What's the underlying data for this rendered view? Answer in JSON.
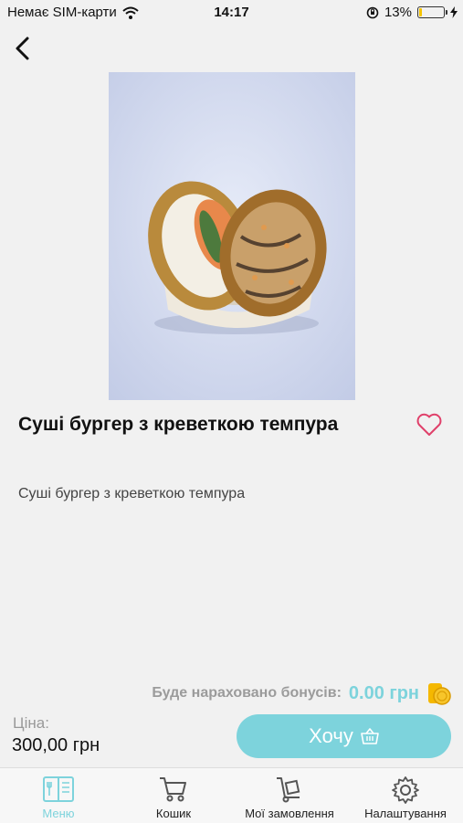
{
  "status_bar": {
    "carrier": "Немає SIM-карти",
    "time": "14:17",
    "battery": "13%",
    "battery_level": 0.13
  },
  "product": {
    "title": "Суші бургер з креветкою темпура",
    "description": "Суші бургер з креветкою темпура"
  },
  "bonus": {
    "label": "Буде нараховано бонусів:",
    "value": "0.00 грн"
  },
  "price": {
    "label": "Ціна:",
    "value": "300,00 грн"
  },
  "action": {
    "want_label": "Хочу"
  },
  "tabs": [
    {
      "label": "Меню",
      "icon": "menu-book-icon",
      "active": true
    },
    {
      "label": "Кошик",
      "icon": "cart-icon",
      "active": false
    },
    {
      "label": "Мої замовлення",
      "icon": "orders-icon",
      "active": false
    },
    {
      "label": "Налаштування",
      "icon": "settings-gear-icon",
      "active": false
    }
  ],
  "colors": {
    "accent": "#7dd3dc",
    "favorite": "#e0406a",
    "bonus_coin": "#f5b800",
    "background": "#f1f1f1"
  }
}
